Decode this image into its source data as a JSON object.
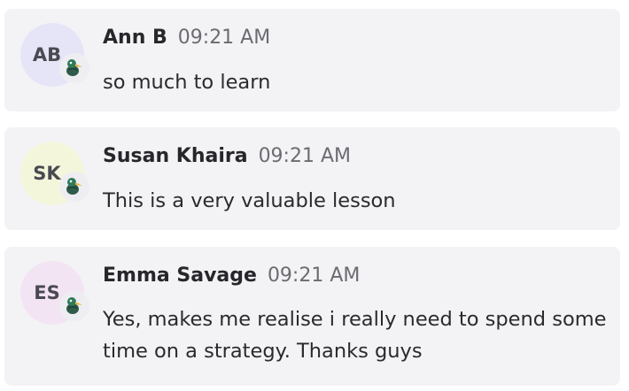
{
  "messages": [
    {
      "initials": "AB",
      "author": "Ann B",
      "time": "09:21 AM",
      "text": "so much to learn",
      "avatar_color": "#e6e4f7"
    },
    {
      "initials": "SK",
      "author": "Susan Khaira",
      "time": "09:21 AM",
      "text": "This is a very valuable lesson",
      "avatar_color": "#f4f6dc"
    },
    {
      "initials": "ES",
      "author": "Emma Savage",
      "time": "09:21 AM",
      "text": "Yes, makes me realise i really need to spend some time on a strategy. Thanks guys",
      "avatar_color": "#f3e4f3"
    }
  ],
  "badge_icon": "duck-icon"
}
